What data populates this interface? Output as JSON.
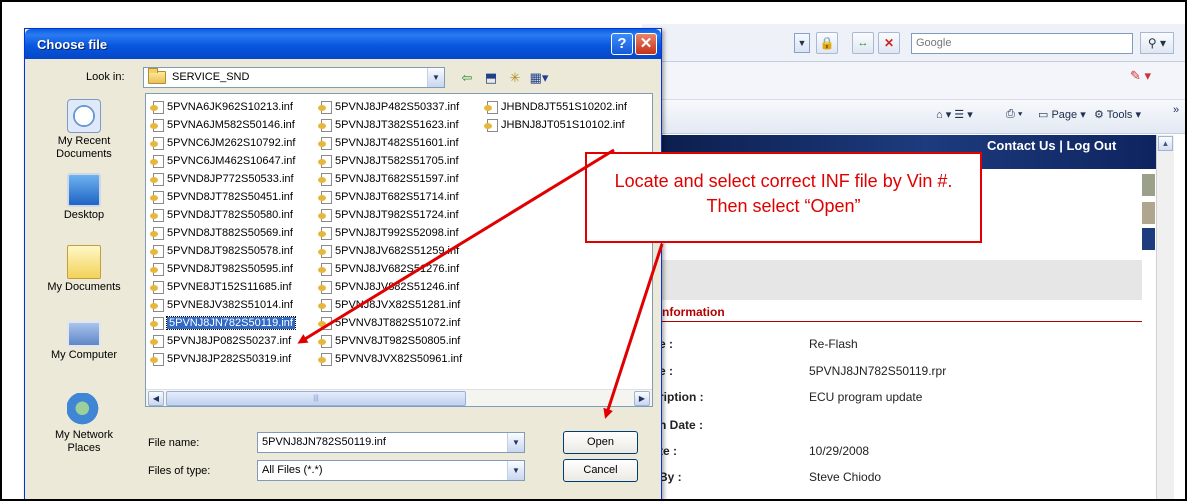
{
  "browser": {
    "search_placeholder": "Google",
    "cmd_page": "Page",
    "cmd_tools": "Tools",
    "contact_logout": "Contact Us | Log Out",
    "section_heading": "nformation",
    "details": [
      {
        "label": "e :",
        "value": "Re-Flash"
      },
      {
        "label": "e :",
        "value": "5PVNJ8JN782S50119.rpr"
      },
      {
        "label": "ription :",
        "value": "ECU program update"
      },
      {
        "label": "n Date :",
        "value": ""
      },
      {
        "label": "te :",
        "value": "10/29/2008"
      },
      {
        "label": "By :",
        "value": "Steve Chiodo"
      }
    ]
  },
  "dialog": {
    "title": "Choose file",
    "help_button": "?",
    "close_button": "✕",
    "look_in_label": "Look in:",
    "look_in_value": "SERVICE_SND",
    "places": [
      {
        "label": "My Recent Documents"
      },
      {
        "label": "Desktop"
      },
      {
        "label": "My Documents"
      },
      {
        "label": "My Computer"
      },
      {
        "label": "My Network Places"
      }
    ],
    "files": {
      "col1": [
        "5PVNA6JK962S10213.inf",
        "5PVNA6JM582S50146.inf",
        "5PVNC6JM262S10792.inf",
        "5PVNC6JM462S10647.inf",
        "5PVND8JP772S50533.inf",
        "5PVND8JT782S50451.inf",
        "5PVND8JT782S50580.inf",
        "5PVND8JT882S50569.inf",
        "5PVND8JT982S50578.inf",
        "5PVND8JT982S50595.inf",
        "5PVNE8JT152S11685.inf",
        "5PVNE8JV382S51014.inf",
        "5PVNJ8JN782S50119.inf",
        "5PVNJ8JP082S50237.inf",
        "5PVNJ8JP282S50319.inf"
      ],
      "col2": [
        "5PVNJ8JP482S50337.inf",
        "5PVNJ8JT382S51623.inf",
        "5PVNJ8JT482S51601.inf",
        "5PVNJ8JT582S51705.inf",
        "5PVNJ8JT682S51597.inf",
        "5PVNJ8JT682S51714.inf",
        "5PVNJ8JT982S51724.inf",
        "5PVNJ8JT992S52098.inf",
        "5PVNJ8JV682S51259.inf",
        "5PVNJ8JV682S51276.inf",
        "5PVNJ8JV882S51246.inf",
        "5PVNJ8JVX82S51281.inf",
        "5PVNV8JT882S51072.inf",
        "5PVNV8JT982S50805.inf",
        "5PVNV8JVX82S50961.inf"
      ],
      "col3": [
        "JHBND8JT551S10202.inf",
        "JHBNJ8JT051S10102.inf"
      ]
    },
    "selected_file": "5PVNJ8JN782S50119.inf",
    "file_name_label": "File name:",
    "file_name_value": "5PVNJ8JN782S50119.inf",
    "file_type_label": "Files of type:",
    "file_type_value": "All Files (*.*)",
    "open_button": "Open",
    "cancel_button": "Cancel"
  },
  "annotation": {
    "line1": "Locate and select correct INF file by Vin #.",
    "line2": "Then select “Open”",
    "color": "#e00000"
  }
}
